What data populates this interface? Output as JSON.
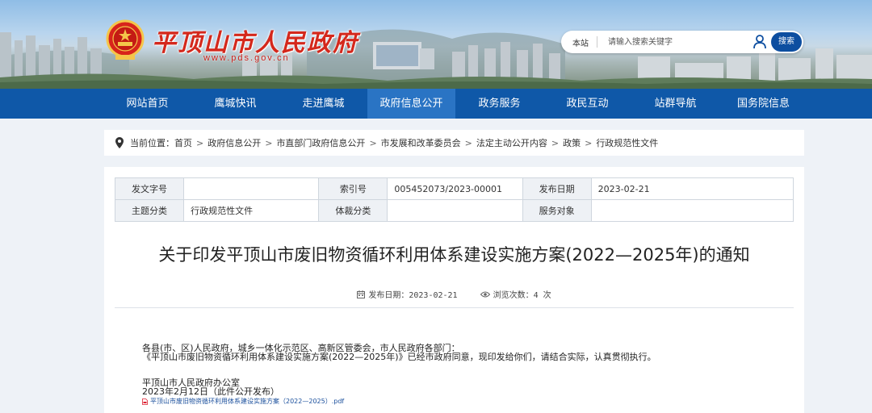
{
  "header": {
    "site_name": "平顶山市人民政府",
    "domain": "www.pds.gov.cn"
  },
  "search": {
    "scope": "本站",
    "placeholder": "请输入搜索关键字",
    "button": "搜索"
  },
  "nav": {
    "items": [
      "网站首页",
      "鹰城快讯",
      "走进鹰城",
      "政府信息公开",
      "政务服务",
      "政民互动",
      "站群导航",
      "国务院信息"
    ],
    "active": "政府信息公开"
  },
  "breadcrumb": {
    "label": "当前位置：",
    "items": [
      "首页",
      "政府信息公开",
      "市直部门政府信息公开",
      "市发展和改革委员会",
      "法定主动公开内容",
      "政策",
      "行政规范性文件"
    ],
    "separator": ">"
  },
  "meta": {
    "doc_no_label": "发文字号",
    "doc_no": "",
    "index_label": "索引号",
    "index": "005452073/2023-00001",
    "pub_date_label": "发布日期",
    "pub_date": "2023-02-21",
    "topic_label": "主题分类",
    "topic": "行政规范性文件",
    "genre_label": "体裁分类",
    "genre": "",
    "audience_label": "服务对象",
    "audience": ""
  },
  "article": {
    "title": "关于印发平顶山市废旧物资循环利用体系建设实施方案(2022—2025年)的通知",
    "date_text": "发布日期：2023-02-21",
    "views_text": "浏览次数：4 次",
    "salutation": "各县(市、区)人民政府，城乡一体化示范区、高新区管委会，市人民政府各部门：",
    "paragraph": "《平顶山市废旧物资循环利用体系建设实施方案(2022—2025年)》已经市政府同意，现印发给你们，请结合实际，认真贯彻执行。",
    "signature": "平顶山市人民政府办公室",
    "sign_date": "2023年2月12日（此件公开发布）",
    "attachment": "平顶山市废旧物资循环利用体系建设实施方案（2022—2025）.pdf"
  },
  "colors": {
    "nav_bg": "#0f58a8",
    "nav_active": "#2a74c4",
    "site_name": "#d4281c",
    "search_button": "#0d4ea0",
    "link": "#1a4f9c"
  }
}
